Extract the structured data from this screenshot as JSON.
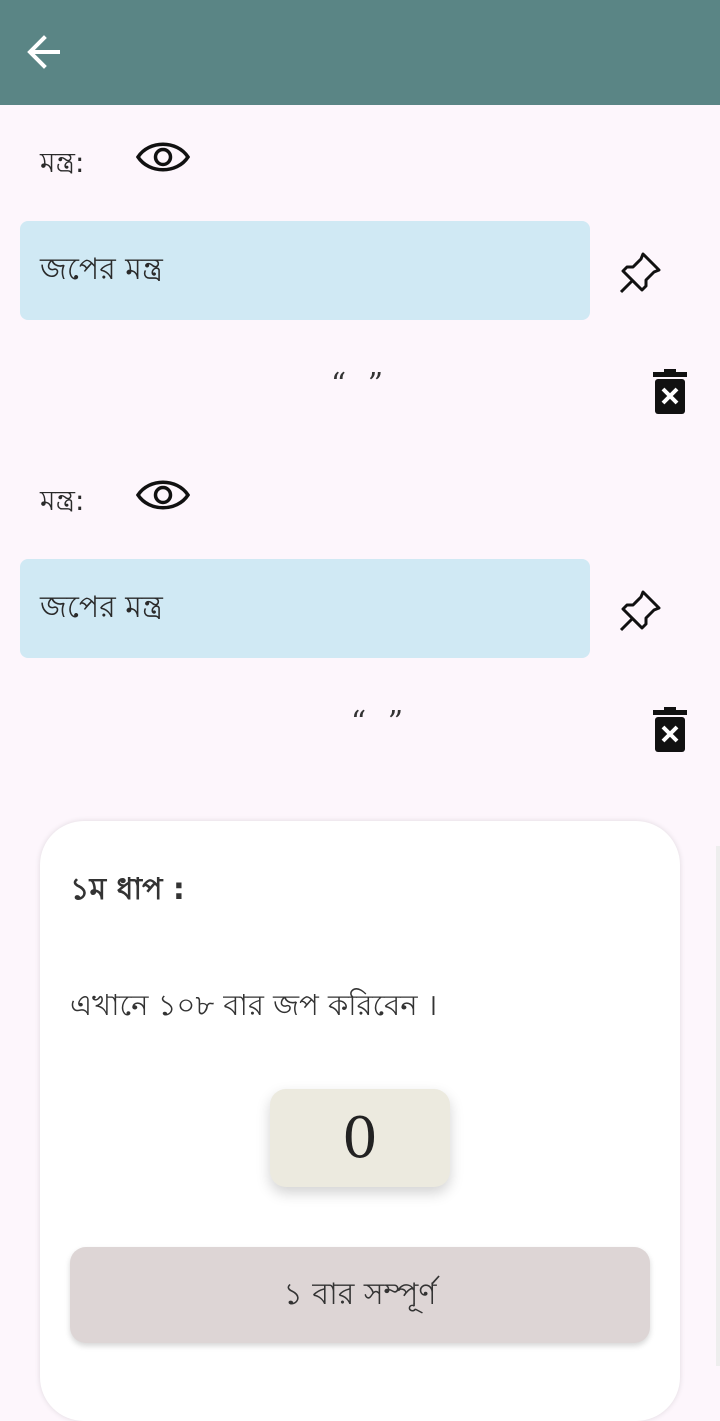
{
  "appbar": {
    "color": "#5a8585",
    "back_icon": "arrow-left-icon"
  },
  "mantras": [
    {
      "label": "মন্ত্র:",
      "visibility_icon": "eye-icon",
      "field_value": "জপের মন্ত্র",
      "pin_icon": "pushpin-icon",
      "quote": "“ ”",
      "delete_icon": "trash-x-icon"
    },
    {
      "label": "মন্ত্র:",
      "visibility_icon": "eye-icon",
      "field_value": "জপের মন্ত্র",
      "pin_icon": "pushpin-icon",
      "quote": "“ ”",
      "delete_icon": "trash-x-icon"
    }
  ],
  "step_card": {
    "title": "১ম ধাপ :",
    "instruction": "এখানে ১০৮ বার জপ করিবেন ।",
    "counter": "0",
    "complete_button": "১ বার সম্পূর্ণ"
  },
  "colors": {
    "background": "#fdf6fc",
    "field": "#d0e9f4",
    "counter_bg": "#eceadf",
    "button_bg": "#ddd5d5"
  }
}
